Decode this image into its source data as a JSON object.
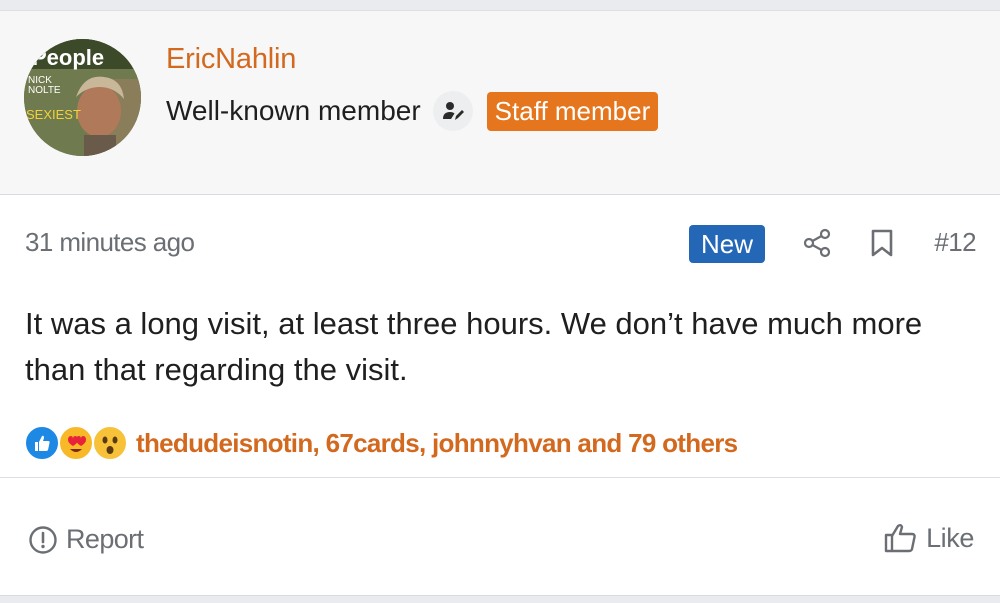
{
  "user": {
    "username": "EricNahlin",
    "title": "Well-known member",
    "badge": "Staff member",
    "avatar_icon": "avatar-magazine-cover",
    "role_icon": "user-edit-icon"
  },
  "post": {
    "timestamp": "31 minutes ago",
    "new_label": "New",
    "number": "#12",
    "message": "It was a long visit, at least three hours. We don’t have much more than that regarding the visit.",
    "share_icon": "share-icon",
    "bookmark_icon": "bookmark-icon"
  },
  "reactions": {
    "icons": [
      "like-reaction-icon",
      "love-reaction-icon",
      "wow-reaction-icon"
    ],
    "text": "thedudeisnotin, 67cards, johnnyhvan and 79 others"
  },
  "footer": {
    "report_label": "Report",
    "like_label": "Like"
  },
  "colors": {
    "accent_orange": "#d2691e",
    "badge_orange": "#e5761e",
    "new_blue": "#2567b7",
    "muted_gray": "#6b6f74"
  },
  "avatar_text": {
    "magazine": "People",
    "name_line1": "NICK",
    "name_line2": "NOLTE",
    "cover_text": "SEXIEST"
  }
}
